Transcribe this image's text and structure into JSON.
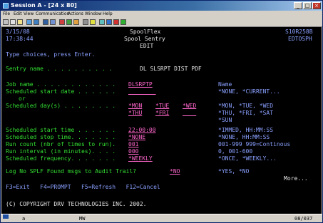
{
  "window": {
    "title": "Session A - [24 x 80]",
    "controls": [
      "_",
      "□",
      "×"
    ]
  },
  "menu": [
    "File",
    "Edit",
    "View",
    "Communication",
    "Actions",
    "Window",
    "Help"
  ],
  "toolbar_icons": [
    "print-icon",
    "copy-icon",
    "paste-icon",
    "send-icon",
    "receive-icon",
    "display-icon",
    "macro-icon",
    "record-icon",
    "play-icon",
    "color-icon",
    "keyboard-icon",
    "help-icon",
    "map-icon",
    "support-icon",
    "stop-icon",
    "go-icon"
  ],
  "header": {
    "date": "3/15/08",
    "time": "17:38:44",
    "system": "SpoolFlex",
    "program": "Spool Sentry",
    "mode": "EDIT",
    "sys_id": "S10R258B",
    "screen_id": "EDTOSPH",
    "instructions": "Type choices, press Enter."
  },
  "sentry": {
    "label": "Sentry name . . . . . . . . . .",
    "value": "DL SLSRPT DIST PDF"
  },
  "fields": {
    "job_name_label": "Job name . . . . . . . . . . . .",
    "job_name_value": "DLSRPTP",
    "job_name_hint": "Name",
    "start_date_label": "Scheduled start date . . . . . .",
    "start_date_hint": "*NONE, *CURRENT...",
    "or_label": "or",
    "days_label": "Scheduled day(s) . . . . . . . .",
    "days_row1": [
      "*MON",
      "*TUE",
      "*WED"
    ],
    "days_row2": [
      "*THU",
      "*FRI"
    ],
    "days_hint1": "*MON, *TUE, *WED",
    "days_hint2": "*THU, *FRI, *SAT",
    "days_hint3": "*SUN",
    "start_time_label": "Scheduled start time . . . . . .",
    "start_time_value": "22:00:00",
    "start_time_hint": "*IMMED, HH:MM:SS",
    "stop_time_label": "Scheduled stop time. . . . . . .",
    "stop_time_value": "*NONE",
    "stop_time_hint": "*NONE, HH:MM:SS",
    "run_count_label": "Run count (nbr of times to run).",
    "run_count_value": "001",
    "run_count_hint": "001-999 999=Continous",
    "run_interval_label": "Run interval (in minutes). . . .",
    "run_interval_value": "000",
    "run_interval_hint": "0, 001-600",
    "frequency_label": "Scheduled frequency. . . . . . .",
    "frequency_value": "*WEEKLY",
    "frequency_hint": "*ONCE, *WEEKLY...",
    "log_label": "Log No SPLF Found msgs to Audit Trail?",
    "log_value": "*NO",
    "log_hint": "*YES, *NO"
  },
  "more": "More...",
  "function_keys": "F3=Exit   F4=PROMPT   F5=Refresh   F12=Cancel",
  "copyright": "(C) COPYRIGHT DRV TECHNOLOGIES INC. 2002.",
  "status": {
    "left": "a",
    "mid": "MW",
    "pos": "08/037"
  }
}
